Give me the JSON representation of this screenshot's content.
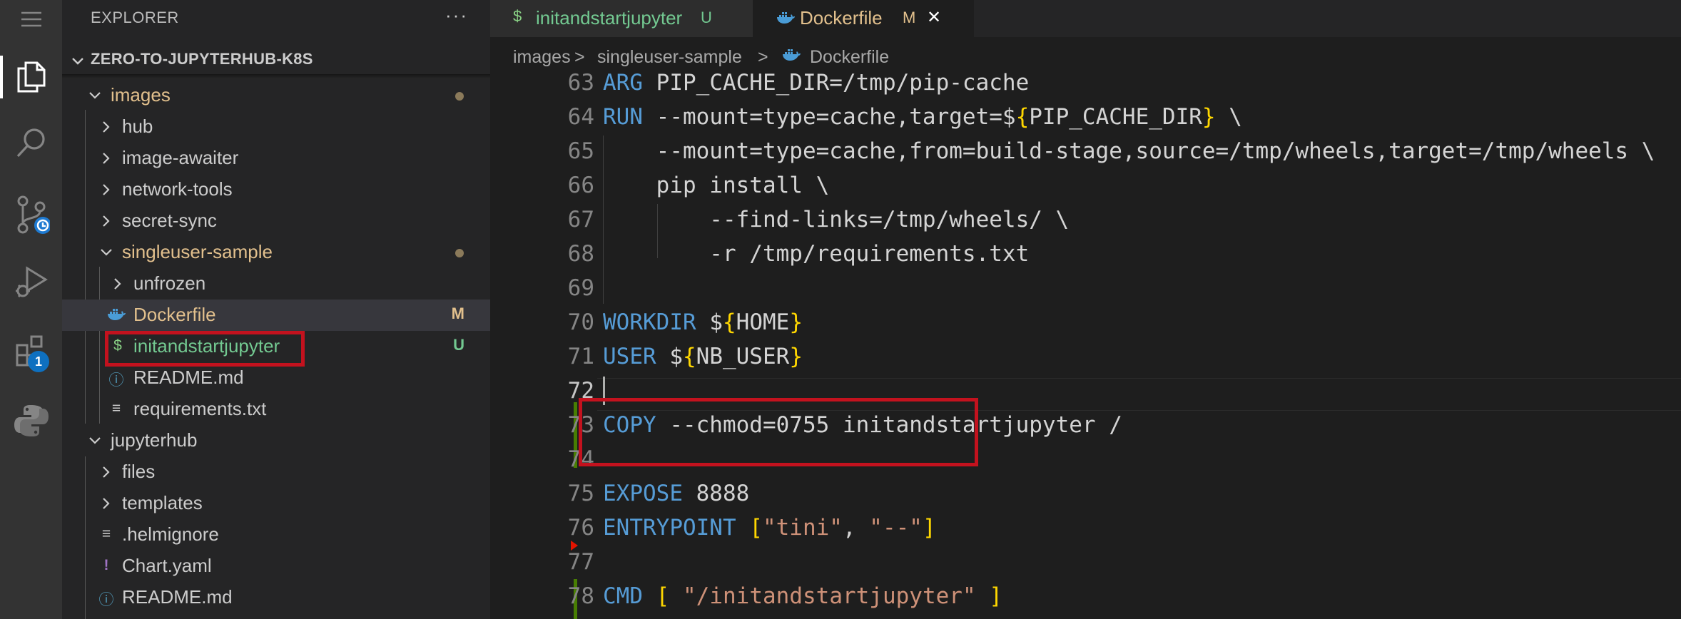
{
  "activity_bar": {
    "extensions_badge": "1"
  },
  "explorer": {
    "title": "EXPLORER",
    "more": "···",
    "project": "ZERO-TO-JUPYTERHUB-K8S",
    "tree": [
      {
        "label": "images",
        "color": "#e2c08d"
      },
      {
        "label": "hub"
      },
      {
        "label": "image-awaiter"
      },
      {
        "label": "network-tools"
      },
      {
        "label": "secret-sync"
      },
      {
        "label": "singleuser-sample",
        "color": "#e2c08d"
      },
      {
        "label": "unfrozen"
      },
      {
        "label": "Dockerfile",
        "color": "#e2c08d",
        "decoration": "M"
      },
      {
        "label": "initandstartjupyter",
        "color": "#73c991",
        "decoration": "U",
        "icon": "$"
      },
      {
        "label": "README.md",
        "icon": "ⓘ"
      },
      {
        "label": "requirements.txt",
        "icon": "≡"
      },
      {
        "label": "jupyterhub"
      },
      {
        "label": "files"
      },
      {
        "label": "templates"
      },
      {
        "label": ".helmignore",
        "icon": "≡"
      },
      {
        "label": "Chart.yaml",
        "icon": "!"
      },
      {
        "label": "README.md",
        "icon": "ⓘ"
      }
    ]
  },
  "tabs": [
    {
      "label": "initandstartjupyter",
      "decoration": "U",
      "icon": "$"
    },
    {
      "label": "Dockerfile",
      "decoration": "M",
      "close": "✕"
    }
  ],
  "breadcrumb": [
    "images",
    "singleuser-sample",
    "Dockerfile"
  ],
  "breadcrumb_sep": ">",
  "code": {
    "line_numbers": [
      "63",
      "64",
      "65",
      "66",
      "67",
      "68",
      "69",
      "70",
      "71",
      "72",
      "73",
      "74",
      "75",
      "76",
      "77",
      "78"
    ],
    "l63a": "ARG",
    "l63b": " PIP_CACHE_DIR=/tmp/pip-cache",
    "l64a": "RUN",
    "l64b": " --mount=type=cache,target=$",
    "l64c": "{",
    "l64d": "PIP_CACHE_DIR",
    "l64e": "}",
    "l64f": " \\",
    "l65": "    --mount=type=cache,from=build-stage,source=/tmp/wheels,target=/tmp/wheels \\",
    "l66": "    pip install \\",
    "l67": "        --find-links=/tmp/wheels/ \\",
    "l68": "        -r /tmp/requirements.txt",
    "l70a": "WORKDIR",
    "l70b": " $",
    "l70c": "{",
    "l70d": "HOME",
    "l70e": "}",
    "l71a": "USER",
    "l71b": " $",
    "l71c": "{",
    "l71d": "NB_USER",
    "l71e": "}",
    "l73a": "COPY",
    "l73b": " --chmod=0755 initandstartjupyter /",
    "l75a": "EXPOSE",
    "l75b": " 8888",
    "l76a": "ENTRYPOINT",
    "l76b": " ",
    "l76c": "[",
    "l76d": "\"tini\"",
    "l76e": ", ",
    "l76f": "\"--\"",
    "l76g": "]",
    "l78a": "CMD",
    "l78b": " ",
    "l78c": "[",
    "l78d": " ",
    "l78e": "\"/initandstartjupyter\"",
    "l78f": " ",
    "l78g": "]"
  }
}
